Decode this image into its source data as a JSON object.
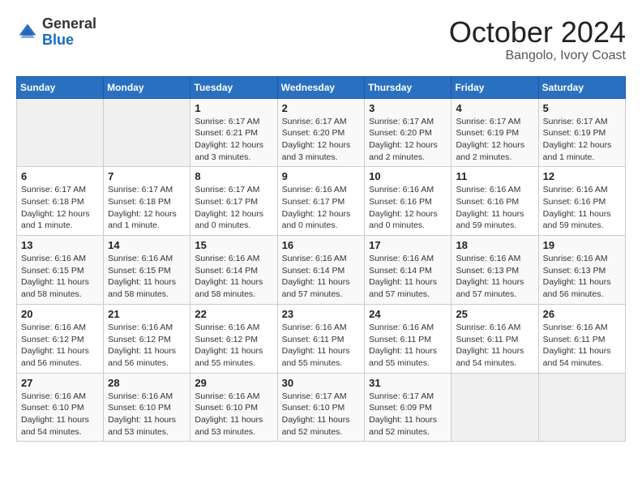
{
  "header": {
    "logo_general": "General",
    "logo_blue": "Blue",
    "month_year": "October 2024",
    "location": "Bangolo, Ivory Coast"
  },
  "calendar": {
    "days_of_week": [
      "Sunday",
      "Monday",
      "Tuesday",
      "Wednesday",
      "Thursday",
      "Friday",
      "Saturday"
    ],
    "weeks": [
      [
        {
          "day": "",
          "info": ""
        },
        {
          "day": "",
          "info": ""
        },
        {
          "day": "1",
          "info": "Sunrise: 6:17 AM\nSunset: 6:21 PM\nDaylight: 12 hours and 3 minutes."
        },
        {
          "day": "2",
          "info": "Sunrise: 6:17 AM\nSunset: 6:20 PM\nDaylight: 12 hours and 3 minutes."
        },
        {
          "day": "3",
          "info": "Sunrise: 6:17 AM\nSunset: 6:20 PM\nDaylight: 12 hours and 2 minutes."
        },
        {
          "day": "4",
          "info": "Sunrise: 6:17 AM\nSunset: 6:19 PM\nDaylight: 12 hours and 2 minutes."
        },
        {
          "day": "5",
          "info": "Sunrise: 6:17 AM\nSunset: 6:19 PM\nDaylight: 12 hours and 1 minute."
        }
      ],
      [
        {
          "day": "6",
          "info": "Sunrise: 6:17 AM\nSunset: 6:18 PM\nDaylight: 12 hours and 1 minute."
        },
        {
          "day": "7",
          "info": "Sunrise: 6:17 AM\nSunset: 6:18 PM\nDaylight: 12 hours and 1 minute."
        },
        {
          "day": "8",
          "info": "Sunrise: 6:17 AM\nSunset: 6:17 PM\nDaylight: 12 hours and 0 minutes."
        },
        {
          "day": "9",
          "info": "Sunrise: 6:16 AM\nSunset: 6:17 PM\nDaylight: 12 hours and 0 minutes."
        },
        {
          "day": "10",
          "info": "Sunrise: 6:16 AM\nSunset: 6:16 PM\nDaylight: 12 hours and 0 minutes."
        },
        {
          "day": "11",
          "info": "Sunrise: 6:16 AM\nSunset: 6:16 PM\nDaylight: 11 hours and 59 minutes."
        },
        {
          "day": "12",
          "info": "Sunrise: 6:16 AM\nSunset: 6:16 PM\nDaylight: 11 hours and 59 minutes."
        }
      ],
      [
        {
          "day": "13",
          "info": "Sunrise: 6:16 AM\nSunset: 6:15 PM\nDaylight: 11 hours and 58 minutes."
        },
        {
          "day": "14",
          "info": "Sunrise: 6:16 AM\nSunset: 6:15 PM\nDaylight: 11 hours and 58 minutes."
        },
        {
          "day": "15",
          "info": "Sunrise: 6:16 AM\nSunset: 6:14 PM\nDaylight: 11 hours and 58 minutes."
        },
        {
          "day": "16",
          "info": "Sunrise: 6:16 AM\nSunset: 6:14 PM\nDaylight: 11 hours and 57 minutes."
        },
        {
          "day": "17",
          "info": "Sunrise: 6:16 AM\nSunset: 6:14 PM\nDaylight: 11 hours and 57 minutes."
        },
        {
          "day": "18",
          "info": "Sunrise: 6:16 AM\nSunset: 6:13 PM\nDaylight: 11 hours and 57 minutes."
        },
        {
          "day": "19",
          "info": "Sunrise: 6:16 AM\nSunset: 6:13 PM\nDaylight: 11 hours and 56 minutes."
        }
      ],
      [
        {
          "day": "20",
          "info": "Sunrise: 6:16 AM\nSunset: 6:12 PM\nDaylight: 11 hours and 56 minutes."
        },
        {
          "day": "21",
          "info": "Sunrise: 6:16 AM\nSunset: 6:12 PM\nDaylight: 11 hours and 56 minutes."
        },
        {
          "day": "22",
          "info": "Sunrise: 6:16 AM\nSunset: 6:12 PM\nDaylight: 11 hours and 55 minutes."
        },
        {
          "day": "23",
          "info": "Sunrise: 6:16 AM\nSunset: 6:11 PM\nDaylight: 11 hours and 55 minutes."
        },
        {
          "day": "24",
          "info": "Sunrise: 6:16 AM\nSunset: 6:11 PM\nDaylight: 11 hours and 55 minutes."
        },
        {
          "day": "25",
          "info": "Sunrise: 6:16 AM\nSunset: 6:11 PM\nDaylight: 11 hours and 54 minutes."
        },
        {
          "day": "26",
          "info": "Sunrise: 6:16 AM\nSunset: 6:11 PM\nDaylight: 11 hours and 54 minutes."
        }
      ],
      [
        {
          "day": "27",
          "info": "Sunrise: 6:16 AM\nSunset: 6:10 PM\nDaylight: 11 hours and 54 minutes."
        },
        {
          "day": "28",
          "info": "Sunrise: 6:16 AM\nSunset: 6:10 PM\nDaylight: 11 hours and 53 minutes."
        },
        {
          "day": "29",
          "info": "Sunrise: 6:16 AM\nSunset: 6:10 PM\nDaylight: 11 hours and 53 minutes."
        },
        {
          "day": "30",
          "info": "Sunrise: 6:17 AM\nSunset: 6:10 PM\nDaylight: 11 hours and 52 minutes."
        },
        {
          "day": "31",
          "info": "Sunrise: 6:17 AM\nSunset: 6:09 PM\nDaylight: 11 hours and 52 minutes."
        },
        {
          "day": "",
          "info": ""
        },
        {
          "day": "",
          "info": ""
        }
      ]
    ]
  }
}
